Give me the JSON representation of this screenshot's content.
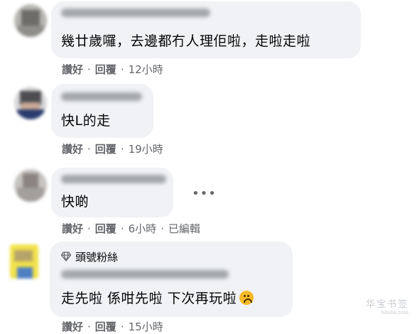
{
  "comments": [
    {
      "text": "幾廿歲囉，去邊都冇人理佢啦，走啦走啦",
      "like_label": "讚好",
      "reply_label": "回覆",
      "time": "12小時",
      "edited": ""
    },
    {
      "text": "快L的走",
      "like_label": "讚好",
      "reply_label": "回覆",
      "time": "19小時",
      "edited": ""
    },
    {
      "text": "快啲",
      "like_label": "讚好",
      "reply_label": "回覆",
      "time": "6小時",
      "edited": "已編輯"
    },
    {
      "badge": "頭號粉絲",
      "text": "走先啦 係咁先啦 下次再玩啦",
      "like_label": "讚好",
      "reply_label": "回覆",
      "time": "15小時",
      "edited": ""
    }
  ],
  "more_label": "•••",
  "watermark": {
    "main": "华宝书签",
    "sub": "hbsbk.com"
  },
  "colors": {
    "bubble": "#f0f2f5",
    "secondary_text": "#65676b",
    "badge_icon": "#65676b"
  }
}
